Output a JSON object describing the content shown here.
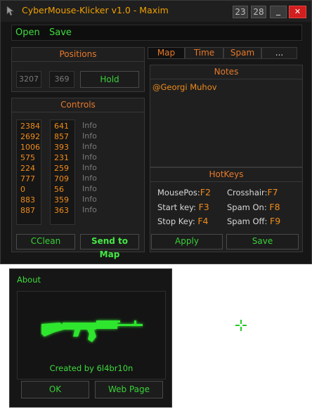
{
  "main_window": {
    "title": "CyberMouse-Klicker v1.0 - Maxim",
    "titlebar_buttons": [
      {
        "label": "23"
      },
      {
        "label": "28"
      },
      {
        "label": "_"
      },
      {
        "label": "✕"
      }
    ]
  },
  "menu": {
    "open": "Open",
    "save": "Save"
  },
  "positions": {
    "header": "Positions",
    "x_value": "3207",
    "y_value": "369",
    "hold_label": "Hold"
  },
  "controls": {
    "header": "Controls",
    "rows": [
      {
        "x": "2384",
        "y": "641",
        "info": "Info"
      },
      {
        "x": "2692",
        "y": "857",
        "info": "Info"
      },
      {
        "x": "1006",
        "y": "393",
        "info": "Info"
      },
      {
        "x": "575",
        "y": "231",
        "info": "Info"
      },
      {
        "x": "224",
        "y": "259",
        "info": "Info"
      },
      {
        "x": "777",
        "y": "709",
        "info": "Info"
      },
      {
        "x": "0",
        "y": "56",
        "info": "Info"
      },
      {
        "x": "883",
        "y": "359",
        "info": "Info"
      },
      {
        "x": "887",
        "y": "363",
        "info": "Info"
      }
    ],
    "cclean_label": "CClean",
    "send_label": "Send to Map"
  },
  "tabs": [
    {
      "label": "Map"
    },
    {
      "label": "Time"
    },
    {
      "label": "Spam"
    },
    {
      "label": "..."
    }
  ],
  "notes": {
    "header": "Notes",
    "text": "@Georgi Muhov"
  },
  "hotkeys": {
    "header": "HotKeys",
    "items": [
      {
        "label": "MousePos:",
        "key": "F2"
      },
      {
        "label": "Crosshair:",
        "key": "F7"
      },
      {
        "label": "Start key:",
        "key": "F3"
      },
      {
        "label": "Spam On:",
        "key": "F8"
      },
      {
        "label": "Stop Key:",
        "key": "F4"
      },
      {
        "label": "Spam Off:",
        "key": "F9"
      }
    ],
    "apply_label": "Apply",
    "save_label": "Save"
  },
  "about": {
    "title": "About",
    "created_by": "Created by 6l4br10n",
    "ok_label": "OK",
    "webpage_label": "Web Page"
  },
  "colors": {
    "accent_orange": "#e8792a",
    "accent_green": "#3ddc3d",
    "title_yellow": "#f0a000",
    "background": "#161616"
  },
  "icons": {
    "app_icon": "mouse-icon",
    "about_image": "rifle-icon",
    "cursor": "crosshair-cursor-icon"
  }
}
